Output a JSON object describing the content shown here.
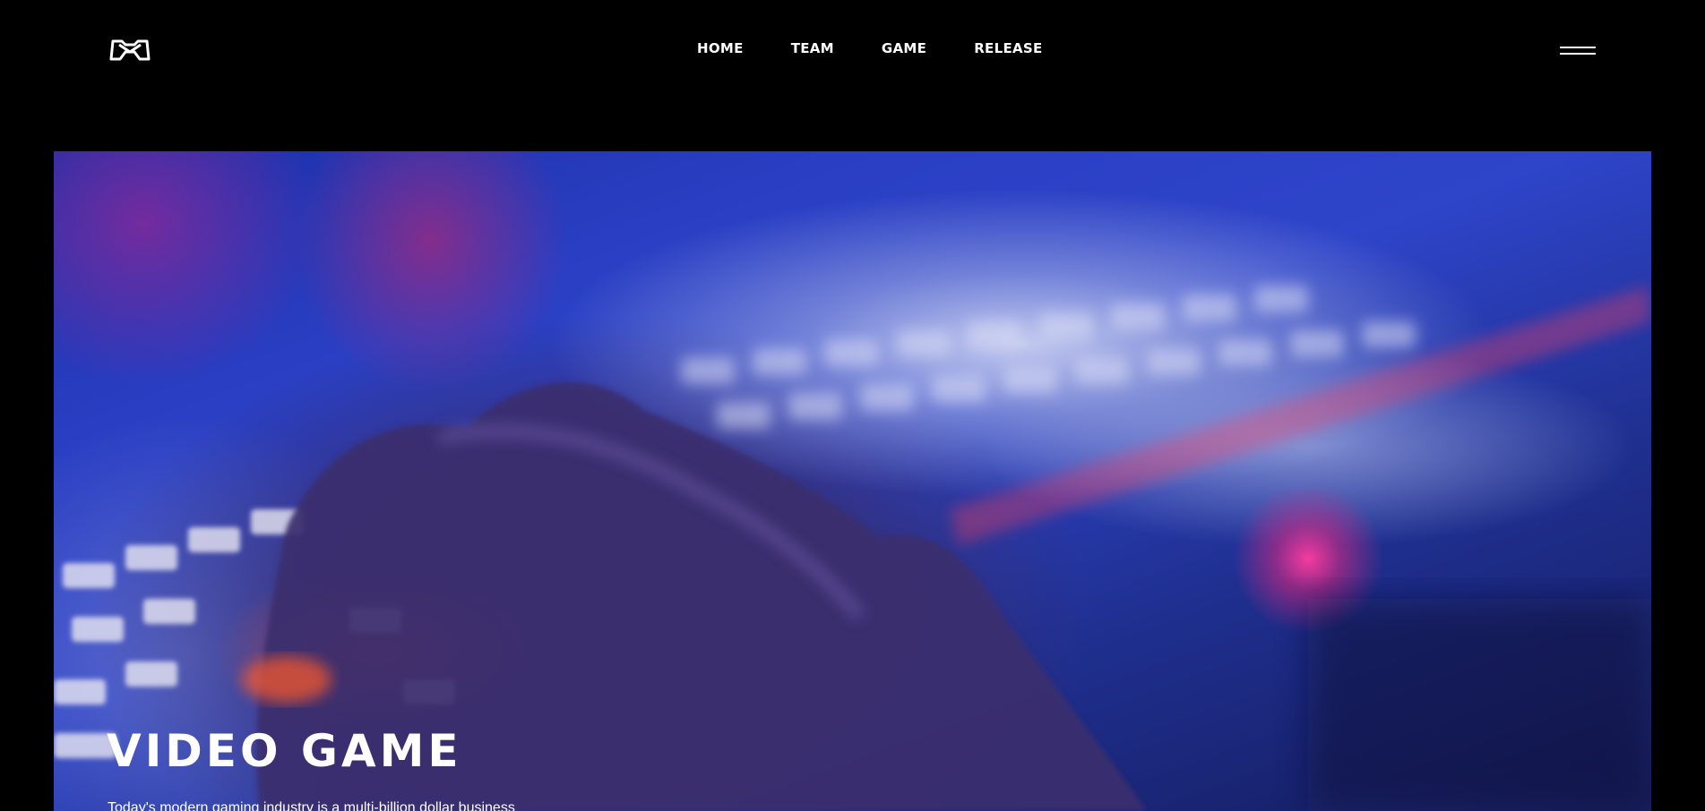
{
  "header": {
    "logo_icon": "game-controller-icon",
    "nav": [
      {
        "label": "HOME"
      },
      {
        "label": "TEAM"
      },
      {
        "label": "GAME"
      },
      {
        "label": "RELEASE"
      }
    ],
    "menu_icon": "hamburger-menu-icon"
  },
  "hero": {
    "title": "VIDEO GAME",
    "description": "Today's modern gaming industry is a multi-billion dollar business"
  },
  "colors": {
    "background": "#000000",
    "text": "#ffffff",
    "hero_blue": "#2a3fc4",
    "hero_accent": "#ff3ca0"
  }
}
